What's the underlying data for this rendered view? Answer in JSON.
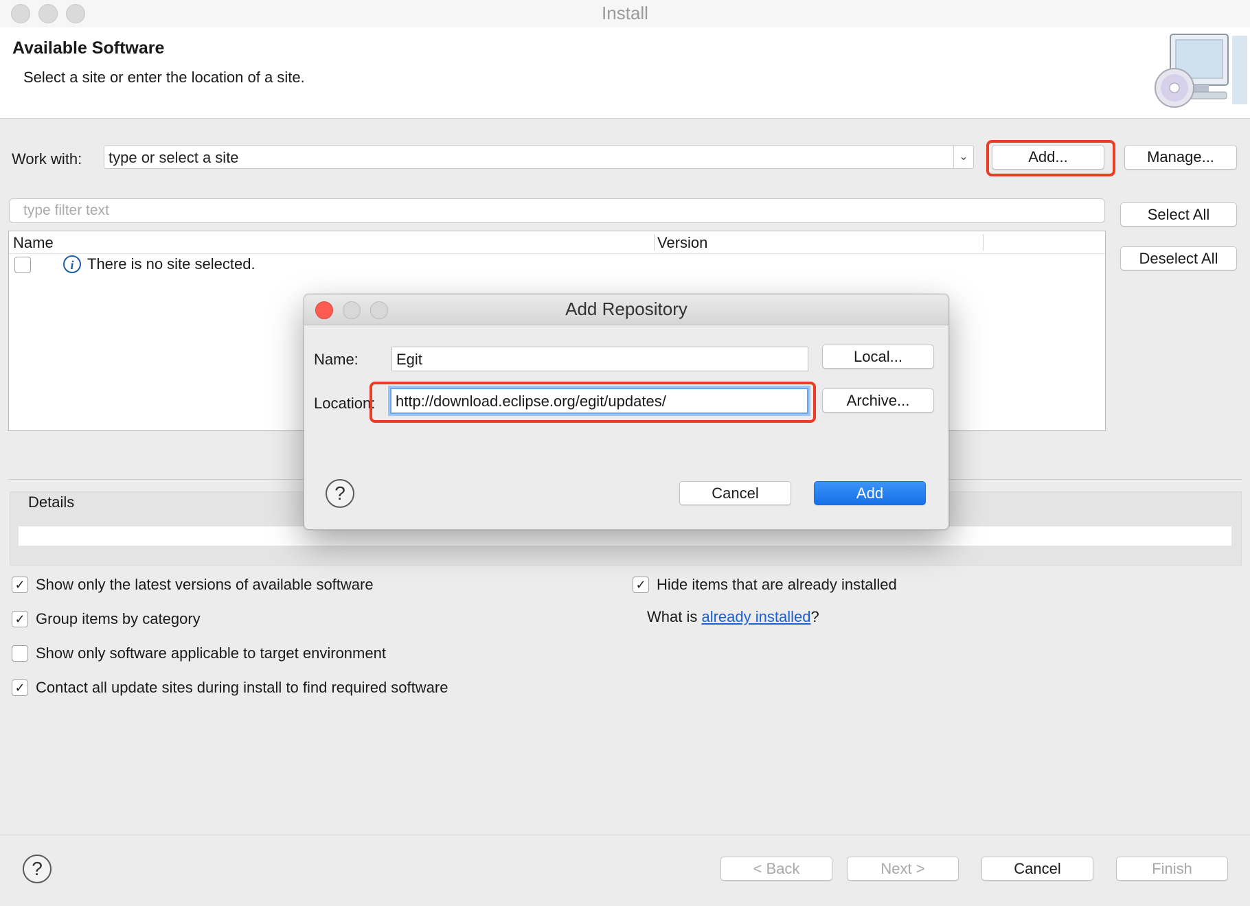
{
  "window": {
    "title": "Install"
  },
  "header": {
    "title": "Available Software",
    "subtitle": "Select a site or enter the location of a site."
  },
  "work_with": {
    "label": "Work with:",
    "placeholder": "type or select a site",
    "add_label": "Add...",
    "manage_label": "Manage..."
  },
  "filter": {
    "placeholder": "type filter text"
  },
  "side_buttons": {
    "select_all": "Select All",
    "deselect_all": "Deselect All"
  },
  "table": {
    "columns": [
      "Name",
      "Version"
    ],
    "message": "There is no site selected."
  },
  "details": {
    "label": "Details"
  },
  "options": {
    "latest_versions": {
      "label": "Show only the latest versions of available software",
      "checked": true
    },
    "group_by_category": {
      "label": "Group items by category",
      "checked": true
    },
    "target_env": {
      "label": "Show only software applicable to target environment",
      "checked": false
    },
    "contact_sites": {
      "label": "Contact all update sites during install to find required software",
      "checked": true
    },
    "hide_installed": {
      "label": "Hide items that are already installed",
      "checked": true
    },
    "what_is_prefix": "What is ",
    "what_is_link": "already installed",
    "what_is_suffix": "?"
  },
  "footer": {
    "back": "< Back",
    "next": "Next >",
    "cancel": "Cancel",
    "finish": "Finish"
  },
  "dialog": {
    "title": "Add Repository",
    "name_label": "Name:",
    "name_value": "Egit",
    "location_label": "Location:",
    "location_value": "http://download.eclipse.org/egit/updates/",
    "local_button": "Local...",
    "archive_button": "Archive...",
    "cancel_button": "Cancel",
    "add_button": "Add"
  },
  "colors": {
    "highlight": "#ea3d23",
    "primary": "#1670e8",
    "link": "#1a5fd6"
  }
}
